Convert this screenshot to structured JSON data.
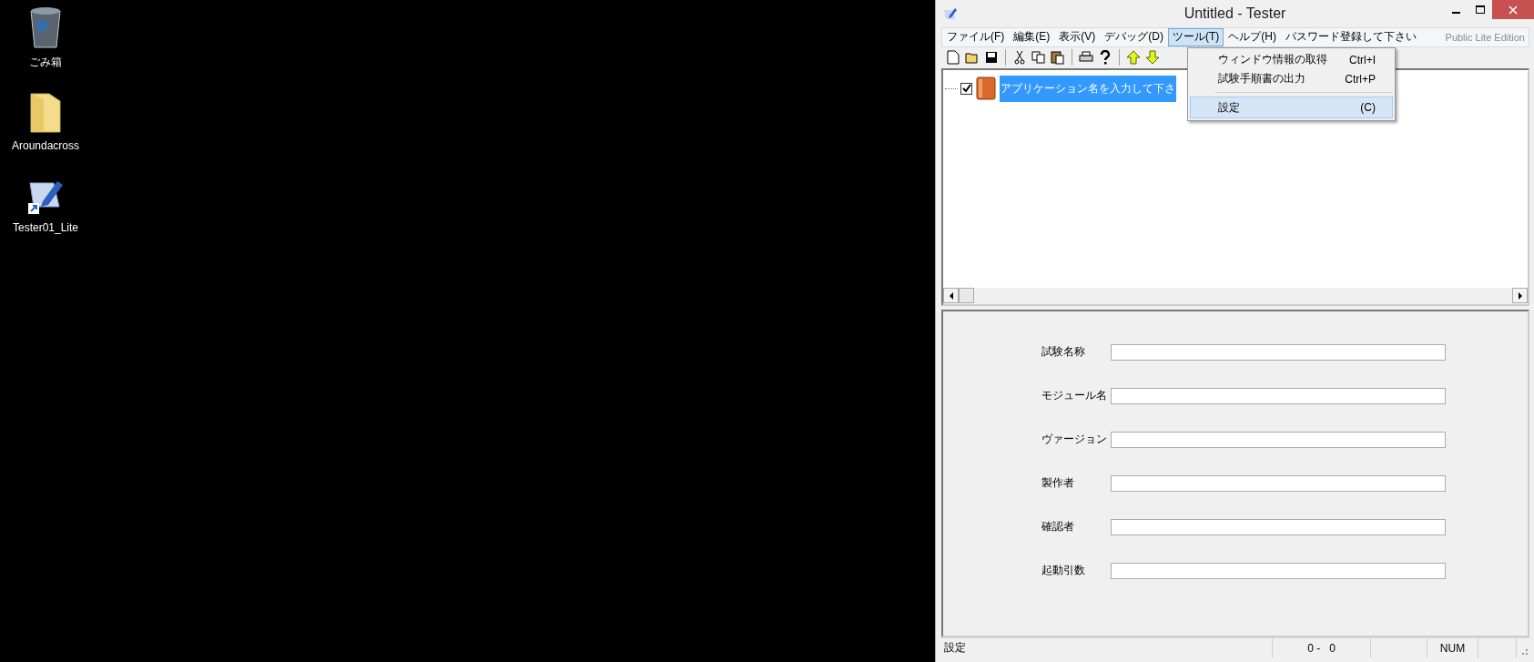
{
  "desktop_icons": [
    {
      "kind": "trash",
      "label": "ごみ箱"
    },
    {
      "kind": "folder",
      "label": "Aroundacross"
    },
    {
      "kind": "shortcut",
      "label": "Tester01_Lite"
    }
  ],
  "window": {
    "title": "Untitled - Tester"
  },
  "menu": [
    {
      "label": "ファイル(F)",
      "selected": false
    },
    {
      "label": "編集(E)",
      "selected": false
    },
    {
      "label": "表示(V)",
      "selected": false
    },
    {
      "label": "デバッグ(D)",
      "selected": false
    },
    {
      "label": "ツール(T)",
      "selected": true
    },
    {
      "label": "ヘルプ(H)",
      "selected": false
    },
    {
      "label": "パスワード登録して下さい",
      "selected": false
    }
  ],
  "edition": "Public Lite Edition",
  "toolbar": [
    {
      "kind": "new"
    },
    {
      "kind": "open"
    },
    {
      "kind": "save"
    },
    {
      "kind": "separator"
    },
    {
      "kind": "cut"
    },
    {
      "kind": "copy"
    },
    {
      "kind": "paste"
    },
    {
      "kind": "separator"
    },
    {
      "kind": "print"
    },
    {
      "kind": "help"
    },
    {
      "kind": "separator"
    },
    {
      "kind": "up"
    },
    {
      "kind": "down"
    }
  ],
  "dropdown": [
    {
      "kind": "item",
      "label": "ウィンドウ情報の取得",
      "shortcut": "Ctrl+I",
      "selected": false
    },
    {
      "kind": "item",
      "label": "試験手順書の出力",
      "shortcut": "Ctrl+P",
      "selected": false
    },
    {
      "kind": "separator"
    },
    {
      "kind": "item",
      "label": "設定",
      "shortcut": "(C)",
      "selected": true
    }
  ],
  "tree": {
    "items": [
      {
        "label": "アプリケーション名を入力して下さ",
        "checked": true,
        "selected": true
      }
    ]
  },
  "form": {
    "fields": [
      {
        "label": "試験名称"
      },
      {
        "label": "モジュール名"
      },
      {
        "label": "ヴァージョン"
      },
      {
        "label": "製作者"
      },
      {
        "label": "確認者"
      },
      {
        "label": "起動引数"
      }
    ]
  },
  "status_bar": {
    "panes": [
      {
        "text": "設定"
      },
      {
        "text": "0 -   0"
      },
      {
        "text": "NUM"
      }
    ]
  }
}
